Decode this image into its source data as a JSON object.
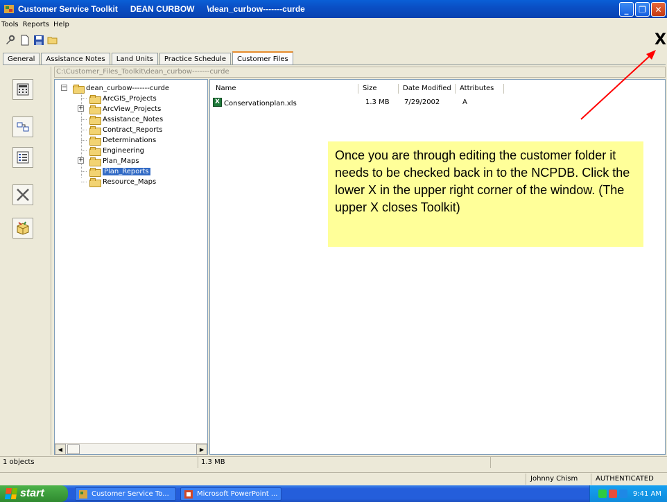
{
  "titlebar": {
    "app_name": "Customer Service Toolkit",
    "user_name": "DEAN CURBOW",
    "folder_path": "\\dean_curbow-------curde"
  },
  "menu": [
    "Tools",
    "Reports",
    "Help"
  ],
  "inner_close_label": "X",
  "tabs": [
    "General",
    "Assistance Notes",
    "Land Units",
    "Practice Schedule",
    "Customer Files"
  ],
  "active_tab": "Customer Files",
  "path": "C:\\Customer_Files_Toolkit\\dean_curbow-------curde",
  "tree": {
    "root": "dean_curbow-------curde",
    "items": [
      {
        "label": "ArcGIS_Projects",
        "expandable": false
      },
      {
        "label": "ArcView_Projects",
        "expandable": true
      },
      {
        "label": "Assistance_Notes",
        "expandable": false
      },
      {
        "label": "Contract_Reports",
        "expandable": false
      },
      {
        "label": "Determinations",
        "expandable": false
      },
      {
        "label": "Engineering",
        "expandable": false
      },
      {
        "label": "Plan_Maps",
        "expandable": true
      },
      {
        "label": "Plan_Reports",
        "expandable": false,
        "selected": true
      },
      {
        "label": "Resource_Maps",
        "expandable": false
      }
    ]
  },
  "file_list": {
    "columns": [
      "Name",
      "Size",
      "Date Modified",
      "Attributes"
    ],
    "rows": [
      {
        "name": "Conservationplan.xls",
        "size": "1.3 MB",
        "date": "7/29/2002",
        "attributes": "A",
        "icon": "excel-file-icon"
      }
    ]
  },
  "callout": "Once you are through editing the customer folder it needs to be checked back in to the NCPDB.  Click the lower X in the upper right corner of the window. (The upper X closes Toolkit)",
  "status": {
    "objects": "1 objects",
    "size": "1.3 MB",
    "user": "Johnny Chism",
    "auth": "AUTHENTICATED"
  },
  "taskbar": {
    "start": "start",
    "tasks": [
      "Customer Service To...",
      "Microsoft PowerPoint ..."
    ],
    "clock": "9:41 AM"
  },
  "colors": {
    "titlebar": "#0A5FD6",
    "callout": "#FFFF99",
    "arrow": "#FF0000",
    "selection": "#316AC5"
  }
}
